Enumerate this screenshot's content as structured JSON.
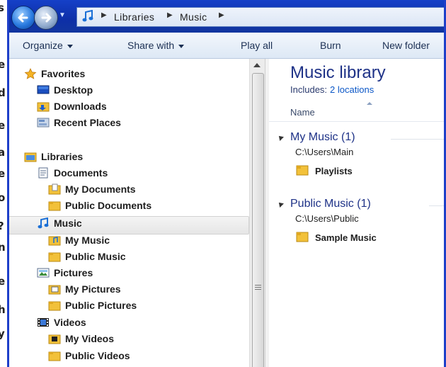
{
  "edge_text": [
    "s",
    "e",
    "d",
    "e",
    "a",
    "e",
    "o",
    "?",
    "n",
    "e",
    "h",
    "y"
  ],
  "address": {
    "crumbs": [
      "Libraries",
      "Music"
    ]
  },
  "toolbar": {
    "organize": "Organize",
    "share_with": "Share with",
    "play_all": "Play all",
    "burn": "Burn",
    "new_folder": "New folder"
  },
  "nav": {
    "favorites": "Favorites",
    "desktop": "Desktop",
    "downloads": "Downloads",
    "recent_places": "Recent Places",
    "libraries": "Libraries",
    "documents": "Documents",
    "my_documents": "My Documents",
    "public_documents": "Public Documents",
    "music": "Music",
    "my_music": "My Music",
    "public_music": "Public Music",
    "pictures": "Pictures",
    "my_pictures": "My Pictures",
    "public_pictures": "Public Pictures",
    "videos": "Videos",
    "my_videos": "My Videos",
    "public_videos": "Public Videos"
  },
  "content": {
    "title": "Music library",
    "includes_label": "Includes:",
    "locations_link": "2 locations",
    "column_name": "Name",
    "groups": [
      {
        "title": "My Music (1)",
        "path": "C:\\Users\\Main",
        "items": [
          "Playlists"
        ]
      },
      {
        "title": "Public Music (1)",
        "path": "C:\\Users\\Public",
        "items": [
          "Sample Music"
        ]
      }
    ]
  },
  "colors": {
    "accent": "#1e3fc9",
    "title_blue": "#1e3287",
    "link_blue": "#0b57c7",
    "folder_yellow": "#f2c13a"
  }
}
